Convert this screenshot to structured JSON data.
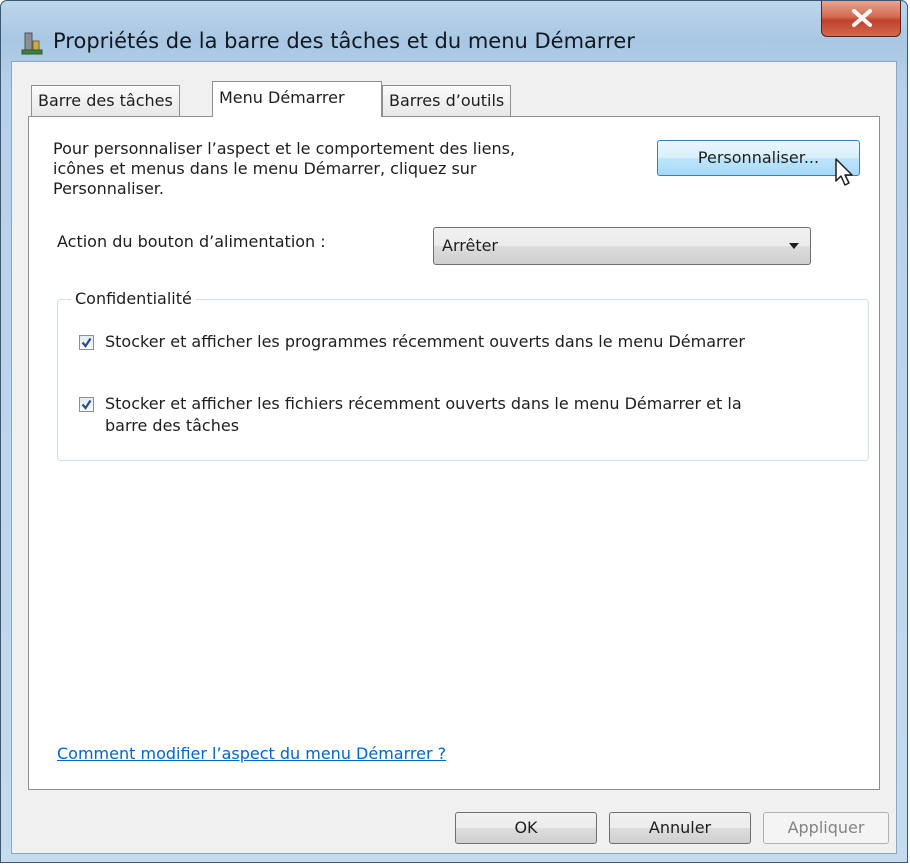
{
  "window": {
    "title": "Propriétés de la barre des tâches et du menu Démarrer",
    "close_symbol": "X"
  },
  "tabs": [
    {
      "label": "Barre des tâches",
      "active": false
    },
    {
      "label": "Menu Démarrer",
      "active": true
    },
    {
      "label": "Barres d’outils",
      "active": false
    }
  ],
  "customize": {
    "description_line1": "Pour personnaliser l’aspect et le comportement des liens,",
    "description_line2": "icônes et menus dans le menu Démarrer, cliquez sur",
    "description_line3": "Personnaliser.",
    "button_label": "Personnaliser..."
  },
  "power_action": {
    "label": "Action du bouton d’alimentation :",
    "selected": "Arrêter"
  },
  "privacy": {
    "title": "Confidentialité",
    "checkbox1": {
      "checked": true,
      "label": "Stocker et afficher les programmes récemment ouverts dans le menu Démarrer"
    },
    "checkbox2": {
      "checked": true,
      "label_line1": "Stocker et afficher les fichiers récemment ouverts dans le menu Démarrer et la",
      "label_line2": "barre des tâches"
    }
  },
  "help_link": "Comment modifier l’aspect du menu Démarrer ?",
  "buttons": {
    "ok": "OK",
    "cancel": "Annuler",
    "apply": "Appliquer"
  },
  "colors": {
    "link": "#0066cc",
    "close_button": "#c0412d",
    "frame": "#a9c7e3"
  }
}
